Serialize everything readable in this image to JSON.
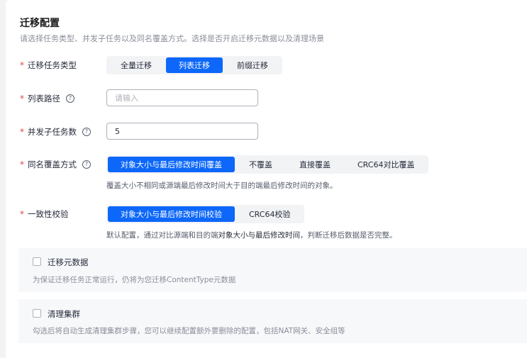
{
  "section": {
    "title": "迁移配置",
    "subtitle": "请选择任务类型、并发子任务以及同名覆盖方式。选择是否开启迁移元数据以及清理场景"
  },
  "task_type": {
    "label": "迁移任务类型",
    "options": [
      "全量迁移",
      "列表迁移",
      "前缀迁移"
    ],
    "selected": "列表迁移"
  },
  "list_path": {
    "label": "列表路径",
    "placeholder": "请输入",
    "value": ""
  },
  "concurrency": {
    "label": "并发子任务数",
    "value": "5"
  },
  "overwrite": {
    "label": "同名覆盖方式",
    "options": [
      "对象大小与最后修改时间覆盖",
      "不覆盖",
      "直接覆盖",
      "CRC64对比覆盖"
    ],
    "selected": "对象大小与最后修改时间覆盖",
    "hint": "覆盖大小不相同或源端最后修改时间大于目的端最后修改时间的对象。"
  },
  "consistency": {
    "label": "一致性校验",
    "options": [
      "对象大小与最后修改时间校验",
      "CRC64校验"
    ],
    "selected": "对象大小与最后修改时间校验",
    "hint_pre": "默认配置，通过对比源端和目的端",
    "hint_em": "对象大小与最后修改时间",
    "hint_post": "，判断迁移后数据是否完整。"
  },
  "metadata": {
    "label": "迁移元数据",
    "checked": false,
    "desc": "为保证迁移任务正常运行，仍将为您迁移ContentType元数据"
  },
  "cleanup": {
    "label": "清理集群",
    "checked": false,
    "desc": "勾选后将自动生成清理集群步骤，您可以继续配置额外要删除的配置，包括NAT网关、安全组等"
  },
  "colors": {
    "primary": "#0c67fa",
    "required": "#e54545"
  }
}
